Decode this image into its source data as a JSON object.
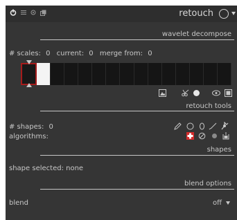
{
  "header": {
    "title": "retouch",
    "icons": [
      "power-icon",
      "presets-menu-icon",
      "reset-icon",
      "multi-instance-icon"
    ]
  },
  "sections": {
    "wavelet": "wavelet decompose",
    "tools": "retouch tools",
    "shapes": "shapes",
    "blend": "blend options"
  },
  "wavelet": {
    "scales_label": "# scales:",
    "scales_value": "0",
    "current_label": "current:",
    "current_value": "0",
    "merge_label": "merge from:",
    "merge_value": "0",
    "cell_count": 15,
    "white_cells": [
      1
    ],
    "current_cell": 0
  },
  "shapes": {
    "count_label": "# shapes:",
    "count_value": "0",
    "algorithms_label": "algorithms:",
    "selected_text": "shape selected: none"
  },
  "blend": {
    "label": "blend",
    "value": "off"
  },
  "colors": {
    "panel": "#353535",
    "header": "#2e2e2e",
    "text": "#c8c8c8",
    "heal_red": "#d42b2b",
    "current_border": "#a51b1b"
  }
}
